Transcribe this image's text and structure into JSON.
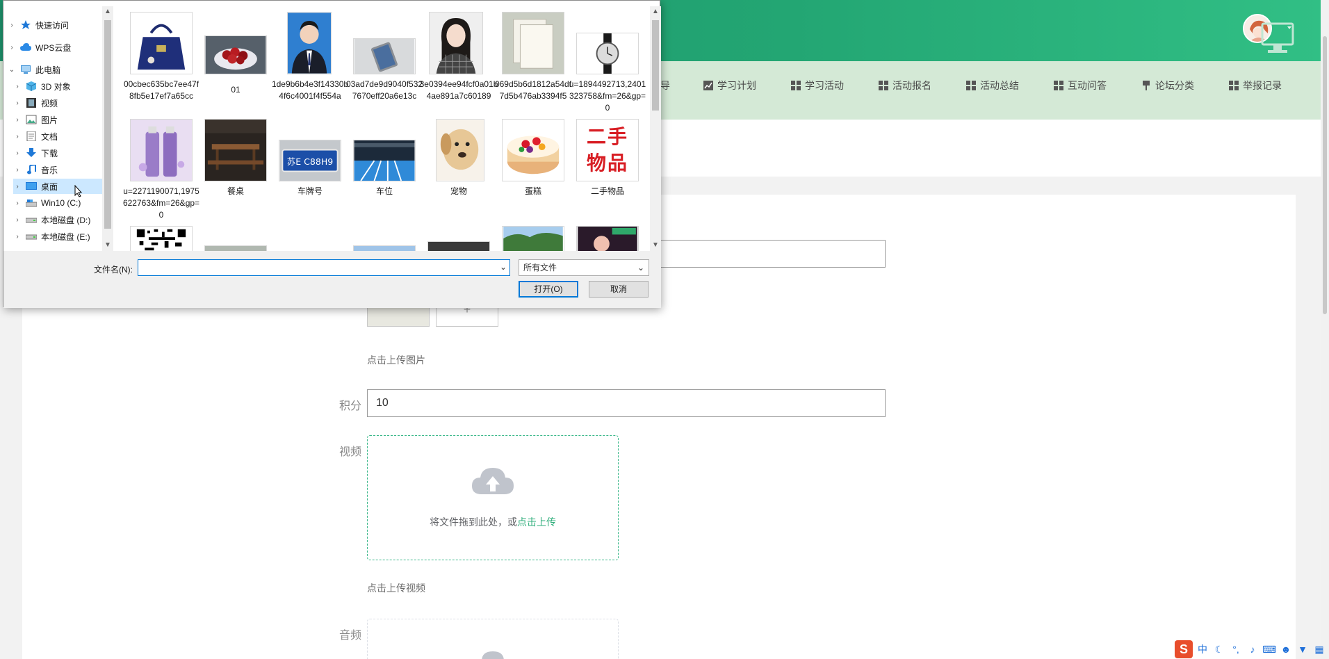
{
  "dialog": {
    "nav_tree": [
      {
        "label": "快速访问",
        "icon": "star-icon",
        "level": 0,
        "expanded": false
      },
      {
        "label": "WPS云盘",
        "icon": "cloud-icon",
        "level": 0,
        "expanded": false
      },
      {
        "label": "此电脑",
        "icon": "computer-icon",
        "level": 0,
        "expanded": true
      },
      {
        "label": "3D 对象",
        "icon": "cube-icon",
        "level": 1
      },
      {
        "label": "视频",
        "icon": "video-icon",
        "level": 1
      },
      {
        "label": "图片",
        "icon": "picture-icon",
        "level": 1
      },
      {
        "label": "文档",
        "icon": "document-icon",
        "level": 1
      },
      {
        "label": "下载",
        "icon": "download-icon",
        "level": 1
      },
      {
        "label": "音乐",
        "icon": "music-icon",
        "level": 1
      },
      {
        "label": "桌面",
        "icon": "desktop-icon",
        "level": 1,
        "selected": true
      },
      {
        "label": "Win10 (C:)",
        "icon": "drive-c-icon",
        "level": 1
      },
      {
        "label": "本地磁盘 (D:)",
        "icon": "drive-icon",
        "level": 1
      },
      {
        "label": "本地磁盘 (E:)",
        "icon": "drive-icon",
        "level": 1
      }
    ],
    "files": [
      {
        "name": "00cbec635bc7ee47f8fb5e17ef7a65cc",
        "thumb": "handbag"
      },
      {
        "name": "01",
        "thumb": "cherries"
      },
      {
        "name": "1de9b6b4e3f14330b4f6c4001f4f554a",
        "thumb": "portrait-man"
      },
      {
        "name": "03ad7de9d9040f5327670eff20a6e13c",
        "thumb": "phone"
      },
      {
        "name": "3e0394ee94fcf0a01b4ae891a7c60189",
        "thumb": "portrait-woman"
      },
      {
        "name": "069d5b6d1812a54df7d5b476ab3394f5",
        "thumb": "notebook"
      },
      {
        "name": "u=1894492713,2401323758&fm=26&gp=0",
        "thumb": "watch"
      },
      {
        "name": "u=2271190071,1975622763&fm=26&gp=0",
        "thumb": "bottles"
      },
      {
        "name": "餐桌",
        "thumb": "table"
      },
      {
        "name": "车牌号",
        "thumb": "plate"
      },
      {
        "name": "车位",
        "thumb": "parking"
      },
      {
        "name": "宠物",
        "thumb": "dog"
      },
      {
        "name": "蛋糕",
        "thumb": "cake"
      },
      {
        "name": "二手物品",
        "thumb": "secondhand"
      }
    ],
    "secondhand_thumb_text": "二手物品",
    "plate_thumb_text": "苏E C88H9",
    "filename_label": "文件名(N):",
    "filename_value": "",
    "filetype_value": "所有文件",
    "open_button": "打开(O)",
    "cancel_button": "取消"
  },
  "page": {
    "nav_items": [
      {
        "label": "导",
        "icon": "grid-icon"
      },
      {
        "label": "学习计划",
        "icon": "chart-icon"
      },
      {
        "label": "学习活动",
        "icon": "grid-icon"
      },
      {
        "label": "活动报名",
        "icon": "grid-icon"
      },
      {
        "label": "活动总结",
        "icon": "grid-icon"
      },
      {
        "label": "互动问答",
        "icon": "grid-icon"
      },
      {
        "label": "论坛分类",
        "icon": "pin-icon"
      },
      {
        "label": "举报记录",
        "icon": "grid-icon"
      }
    ],
    "image_upload_hint": "点击上传图片",
    "plus_label": "+",
    "points_label": "积分",
    "points_value": "10",
    "video_label": "视频",
    "dropzone_text": "将文件拖到此处，或",
    "dropzone_link": "点击上传",
    "video_upload_hint": "点击上传视频",
    "audio_label": "音频"
  },
  "tray": {
    "ime_logo": "S",
    "ime_lang": "中",
    "icons": [
      "moon-icon",
      "punct-icon",
      "mic-icon",
      "keyboard-icon",
      "user-icon",
      "shirt-icon",
      "grid-icon"
    ]
  },
  "colors": {
    "header_green": "#23a673",
    "nav_bg": "#d4e9d6",
    "accent": "#2fae7b",
    "selection": "#cce8ff",
    "focus_blue": "#0078d7"
  }
}
